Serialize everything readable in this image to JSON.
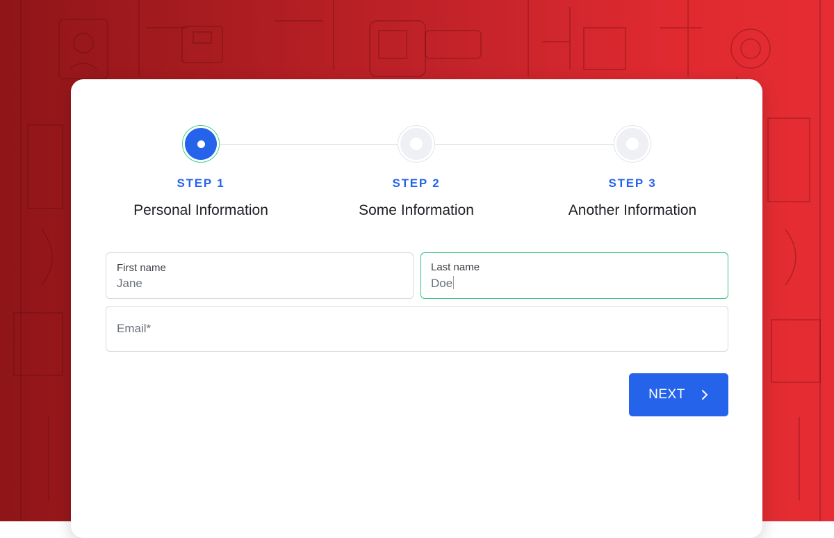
{
  "stepper": {
    "steps": [
      {
        "number": "STEP 1",
        "title": "Personal Information",
        "state": "active"
      },
      {
        "number": "STEP 2",
        "title": "Some Information",
        "state": "inactive"
      },
      {
        "number": "STEP 3",
        "title": "Another Information",
        "state": "inactive"
      }
    ]
  },
  "form": {
    "first_name": {
      "label": "First name",
      "value": "Jane"
    },
    "last_name": {
      "label": "Last name",
      "value": "Doe"
    },
    "email": {
      "placeholder": "Email*"
    }
  },
  "actions": {
    "next_label": "NEXT",
    "next_icon": "chevron-right-icon"
  },
  "colors": {
    "accent": "#2563eb",
    "focus_border": "#34c281",
    "background_red": "#c4232a"
  }
}
